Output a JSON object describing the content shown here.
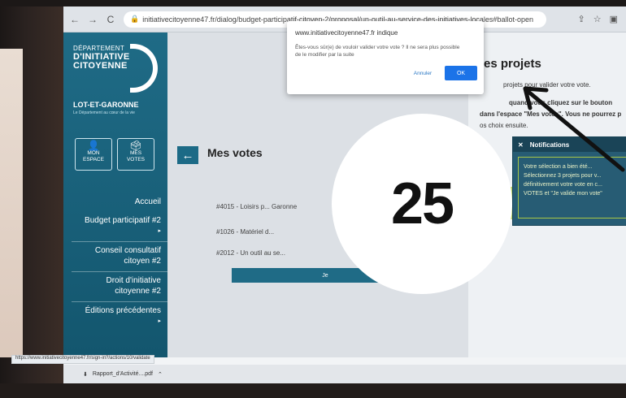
{
  "browser": {
    "url": "initiativecitoyenne47.fr/dialog/budget-participatif-citoyen-2/proposal/un-outil-au-service-des-initiatives-locales#ballot-open",
    "status_link": "https://www.initiativecitoyenne47.fr/sign-in?/actions/10/validate"
  },
  "sidebar": {
    "logo_lines": [
      "DÉPARTEMENT",
      "D'INITIATIVE",
      "CITOYENNE"
    ],
    "brand": "LOT-ET-GARONNE",
    "brand_sub": "Le Département au cœur de la vie",
    "quick_links": [
      {
        "label_line1": "MON",
        "label_line2": "ESPACE",
        "icon": "user-icon"
      },
      {
        "label_line1": "MES",
        "label_line2": "VOTES",
        "icon": "ballot-icon"
      }
    ],
    "menu": [
      {
        "label": "Accueil"
      },
      {
        "label": "Budget participatif #2"
      },
      {
        "label": "Conseil consultatif citoyen #2"
      },
      {
        "label": "Droit d'initiative citoyenne #2"
      },
      {
        "label": "Éditions précédentes"
      }
    ]
  },
  "main": {
    "title": "Mes votes",
    "votes": [
      {
        "text": "#4015 - Loisirs p... Garonne"
      },
      {
        "text": "#1026 - Matériel d..."
      },
      {
        "text": "#2012 - Un outil au se..."
      }
    ],
    "validate_label": "Je"
  },
  "right": {
    "title": "es projets",
    "line1": "projets pour valider votre vote.",
    "line2": "quand vous cliquez sur le bouton",
    "line3": "dans l'espace \"Mes votes\". Vous ne pourrez p",
    "line4": "os choix ensuite."
  },
  "notification": {
    "title": "Notifications",
    "body": "Votre sélection a bien été... Sélectionnez 3 projets pour v... définitivement votre vote en c... VOTES et \"Je valide mon vote\""
  },
  "dialog": {
    "title": "www.initiativecitoyenne47.fr indique",
    "message": "Êtes-vous sûr(e) de vouloir valider votre vote ? Il ne sera plus possible de le modifier par la suite",
    "cancel_label": "Annuler",
    "ok_label": "OK"
  },
  "step": {
    "number": "25"
  },
  "taskbar": {
    "download_label": "Rapport_d'Activité....pdf"
  }
}
